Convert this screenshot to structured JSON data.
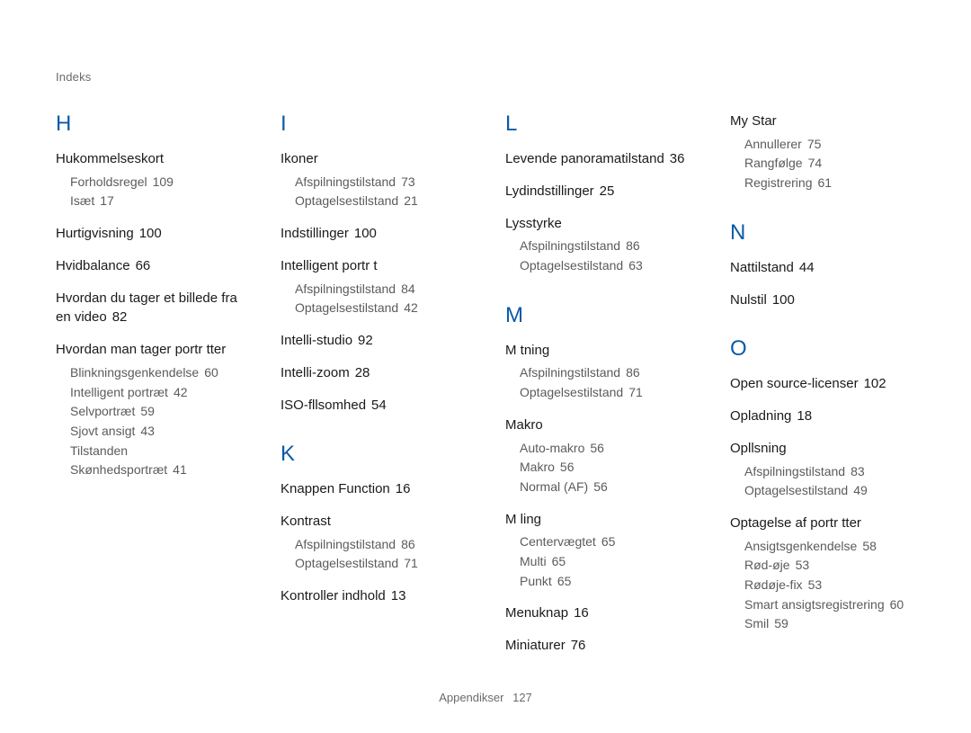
{
  "running_head": "Indeks",
  "footer": {
    "label": "Appendikser",
    "page": "127"
  },
  "columns": [
    {
      "sections": [
        {
          "letter": "H",
          "groups": [
            {
              "head": "Hukommelseskort",
              "subs": [
                {
                  "label": "Forholdsregel",
                  "page": "109"
                },
                {
                  "label": "Isæt",
                  "page": "17"
                }
              ]
            },
            {
              "head": "Hurtigvisning",
              "page": "100"
            },
            {
              "head": "Hvidbalance",
              "page": "66"
            },
            {
              "head": "Hvordan du tager et billede fra en video",
              "page": "82"
            },
            {
              "head": "Hvordan man tager portr tter",
              "subs": [
                {
                  "label": "Blinkningsgenkendelse",
                  "page": "60"
                },
                {
                  "label": "Intelligent portræt",
                  "page": "42"
                },
                {
                  "label": "Selvportræt",
                  "page": "59"
                },
                {
                  "label": "Sjovt ansigt",
                  "page": "43"
                },
                {
                  "label": "Tilstanden Skønhedsportræt",
                  "page": "41"
                }
              ]
            }
          ]
        }
      ]
    },
    {
      "sections": [
        {
          "letter": "I",
          "groups": [
            {
              "head": "Ikoner",
              "subs": [
                {
                  "label": "Afspilningstilstand",
                  "page": "73"
                },
                {
                  "label": "Optagelsestilstand",
                  "page": "21"
                }
              ]
            },
            {
              "head": "Indstillinger",
              "page": "100"
            },
            {
              "head": "Intelligent portr t",
              "subs": [
                {
                  "label": "Afspilningstilstand",
                  "page": "84"
                },
                {
                  "label": "Optagelsestilstand",
                  "page": "42"
                }
              ]
            },
            {
              "head": "Intelli-studio",
              "page": "92"
            },
            {
              "head": "Intelli-zoom",
              "page": "28"
            },
            {
              "head": "ISO-fllsomhed",
              "page": "54"
            }
          ]
        },
        {
          "letter": "K",
          "groups": [
            {
              "head": "Knappen Function",
              "page": "16"
            },
            {
              "head": "Kontrast",
              "subs": [
                {
                  "label": "Afspilningstilstand",
                  "page": "86"
                },
                {
                  "label": "Optagelsestilstand",
                  "page": "71"
                }
              ]
            },
            {
              "head": "Kontroller indhold",
              "page": "13"
            }
          ]
        }
      ]
    },
    {
      "sections": [
        {
          "letter": "L",
          "groups": [
            {
              "head": "Levende panoramatilstand",
              "page": "36"
            },
            {
              "head": "Lydindstillinger",
              "page": "25"
            },
            {
              "head": "Lysstyrke",
              "subs": [
                {
                  "label": "Afspilningstilstand",
                  "page": "86"
                },
                {
                  "label": "Optagelsestilstand",
                  "page": "63"
                }
              ]
            }
          ]
        },
        {
          "letter": "M",
          "groups": [
            {
              "head": "M tning",
              "subs": [
                {
                  "label": "Afspilningstilstand",
                  "page": "86"
                },
                {
                  "label": "Optagelsestilstand",
                  "page": "71"
                }
              ]
            },
            {
              "head": "Makro",
              "subs": [
                {
                  "label": "Auto-makro",
                  "page": "56"
                },
                {
                  "label": "Makro",
                  "page": "56"
                },
                {
                  "label": "Normal (AF)",
                  "page": "56"
                }
              ]
            },
            {
              "head": "M ling",
              "subs": [
                {
                  "label": "Centervægtet",
                  "page": "65"
                },
                {
                  "label": "Multi",
                  "page": "65"
                },
                {
                  "label": "Punkt",
                  "page": "65"
                }
              ]
            },
            {
              "head": "Menuknap",
              "page": "16"
            },
            {
              "head": "Miniaturer",
              "page": "76"
            }
          ]
        }
      ]
    },
    {
      "sections": [
        {
          "letter": null,
          "groups": [
            {
              "head": "My Star",
              "subs": [
                {
                  "label": "Annullerer",
                  "page": "75"
                },
                {
                  "label": "Rangfølge",
                  "page": "74"
                },
                {
                  "label": "Registrering",
                  "page": "61"
                }
              ]
            }
          ]
        },
        {
          "letter": "N",
          "groups": [
            {
              "head": "Nattilstand",
              "page": "44"
            },
            {
              "head": "Nulstil",
              "page": "100"
            }
          ]
        },
        {
          "letter": "O",
          "groups": [
            {
              "head": "Open source-licenser",
              "page": "102"
            },
            {
              "head": "Opladning",
              "page": "18"
            },
            {
              "head": "Opllsning",
              "subs": [
                {
                  "label": "Afspilningstilstand",
                  "page": "83"
                },
                {
                  "label": "Optagelsestilstand",
                  "page": "49"
                }
              ]
            },
            {
              "head": "Optagelse af portr tter",
              "subs": [
                {
                  "label": "Ansigtsgenkendelse",
                  "page": "58"
                },
                {
                  "label": "Rød-øje",
                  "page": "53"
                },
                {
                  "label": "Rødøje-fix",
                  "page": "53"
                },
                {
                  "label": "Smart ansigtsregistrering",
                  "page": "60"
                },
                {
                  "label": "Smil",
                  "page": "59"
                }
              ]
            }
          ]
        }
      ]
    }
  ]
}
